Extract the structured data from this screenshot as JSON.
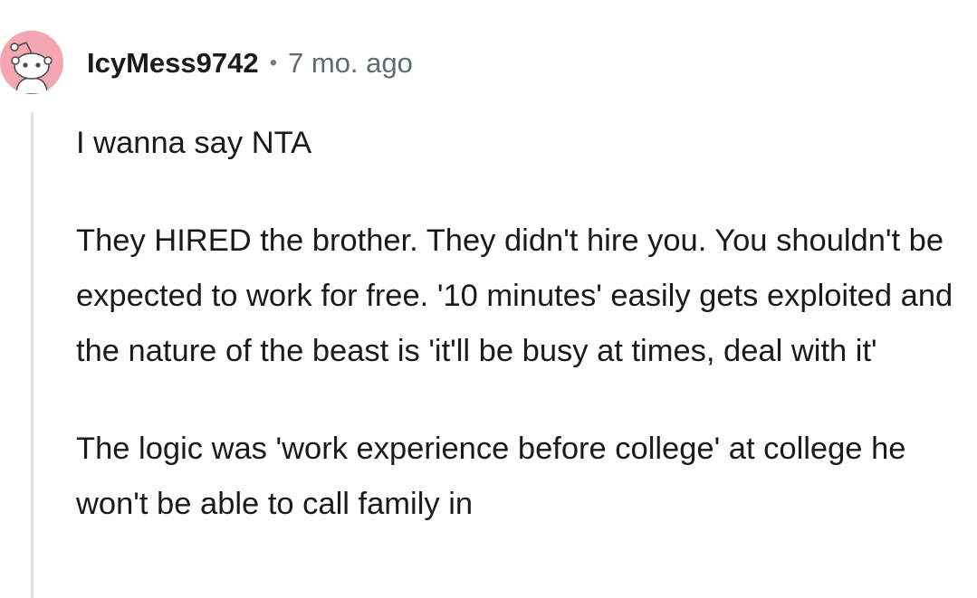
{
  "comment": {
    "username": "IcyMess9742",
    "separator": "•",
    "timestamp": "7 mo. ago",
    "paragraphs": [
      "I wanna say NTA",
      "They HIRED the brother. They didn't hire you. You shouldn't be expected to work for free. '10 minutes' easily gets exploited and the nature of the beast is 'it'll be busy at times, deal with it'",
      "The logic was 'work experience before college' at college he won't be able to call family in"
    ],
    "avatar_icon": "reddit-snoo-avatar-icon"
  },
  "colors": {
    "avatar_background": "#f4a7b0",
    "text": "#1a1a1b",
    "muted": "#5f6b73",
    "thread_line": "#e2e2e2"
  }
}
